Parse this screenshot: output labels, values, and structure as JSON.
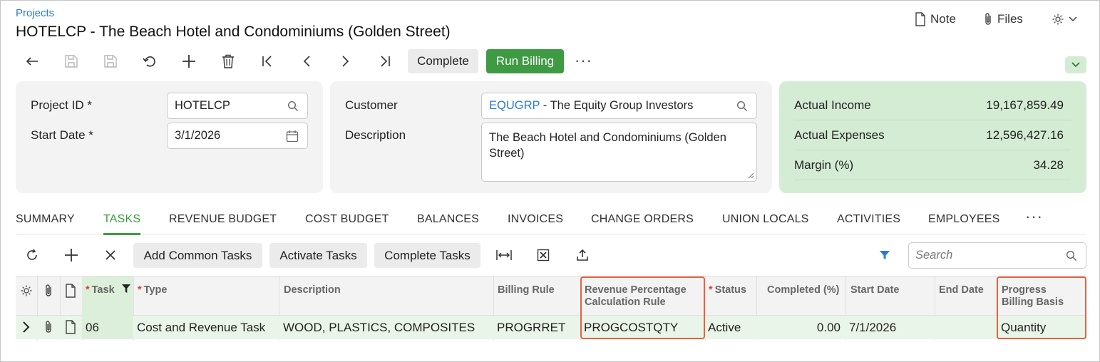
{
  "header": {
    "breadcrumb": "Projects",
    "title": "HOTELCP - The Beach Hotel and Condominiums (Golden Street)",
    "note_label": "Note",
    "files_label": "Files"
  },
  "toolbar": {
    "complete_label": "Complete",
    "run_billing_label": "Run Billing",
    "more_label": "···",
    "icons": [
      "back-icon",
      "save-close-icon",
      "save-icon",
      "undo-icon",
      "add-icon",
      "delete-icon",
      "first-icon",
      "previous-icon",
      "next-icon",
      "last-icon"
    ]
  },
  "form": {
    "project_id_label": "Project ID",
    "project_id_value": "HOTELCP",
    "start_date_label": "Start Date",
    "start_date_value": "3/1/2026",
    "required_mark": "*",
    "customer_label": "Customer",
    "customer_code": "EQUGRP",
    "customer_name": " - The Equity Group Investors",
    "description_label": "Description",
    "description_value": "The Beach Hotel and Condominiums (Golden Street)"
  },
  "summary": {
    "rows": [
      {
        "label": "Actual Income",
        "value": "19,167,859.49"
      },
      {
        "label": "Actual Expenses",
        "value": "12,596,427.16"
      },
      {
        "label": "Margin (%)",
        "value": "34.28"
      }
    ]
  },
  "tabs": [
    "SUMMARY",
    "TASKS",
    "REVENUE BUDGET",
    "COST BUDGET",
    "BALANCES",
    "INVOICES",
    "CHANGE ORDERS",
    "UNION LOCALS",
    "ACTIVITIES",
    "EMPLOYEES"
  ],
  "active_tab": "TASKS",
  "grid_toolbar": {
    "add_common_tasks": "Add Common Tasks",
    "activate_tasks": "Activate Tasks",
    "complete_tasks": "Complete Tasks",
    "search_placeholder": "Search"
  },
  "grid": {
    "columns": {
      "task": "Task",
      "type": "Type",
      "description": "Description",
      "billing_rule": "Billing Rule",
      "revenue_pct_rule": [
        "Revenue Percentage",
        "Calculation Rule"
      ],
      "status": "Status",
      "completed": "Completed (%)",
      "start_date": "Start Date",
      "end_date": "End Date",
      "progress_billing_basis": [
        "Progress",
        "Billing Basis"
      ]
    },
    "rows": [
      {
        "task": "06",
        "type": "Cost and Revenue Task",
        "description": "WOOD, PLASTICS, COMPOSITES",
        "billing_rule": "PROGRRET",
        "revenue_pct_rule": "PROGCOSTQTY",
        "status": "Active",
        "completed": "0.00",
        "start_date": "7/1/2026",
        "end_date": "",
        "progress_billing_basis": "Quantity"
      }
    ]
  },
  "colors": {
    "accent_green": "#3e9a43",
    "link_blue": "#2a7ad8",
    "highlight_orange": "#e8613e",
    "summary_bg": "#d4ecd3",
    "row_bg": "#e9f5e8"
  }
}
